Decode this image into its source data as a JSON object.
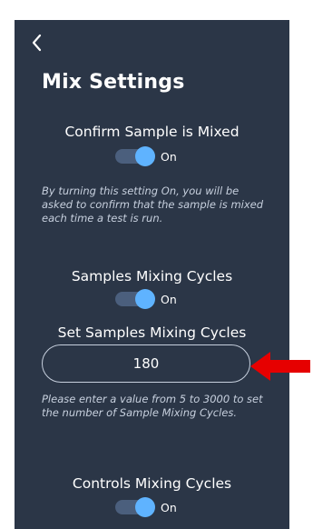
{
  "header": {
    "back_icon": "chevron-left-icon",
    "title": "Mix Settings"
  },
  "confirm_sample_mixed": {
    "label": "Confirm Sample is Mixed",
    "toggle_state": "On",
    "help_text": "By turning this setting On, you will be asked to confirm that the sample is mixed each time a test is run."
  },
  "samples_mixing_cycles": {
    "label": "Samples Mixing Cycles",
    "toggle_state": "On"
  },
  "set_samples_mixing_cycles": {
    "label": "Set Samples Mixing Cycles",
    "value": "180",
    "help_text": "Please enter a value from 5 to 3000 to set the number of Sample Mixing Cycles."
  },
  "controls_mixing_cycles": {
    "label": "Controls Mixing Cycles",
    "toggle_state": "On"
  },
  "colors": {
    "panel_background": "#2b3647",
    "toggle_knob": "#5fb3ff",
    "toggle_track": "#4b5f7d",
    "help_text": "#c7d0de",
    "annotation_arrow": "#e60000"
  },
  "annotation": {
    "icon": "red-arrow-icon"
  }
}
